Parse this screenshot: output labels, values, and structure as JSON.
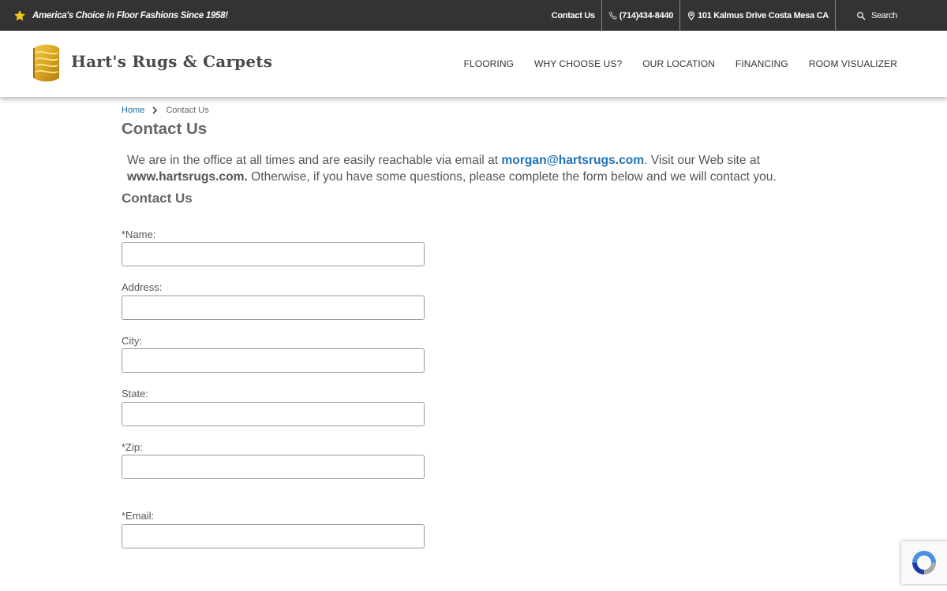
{
  "topbar": {
    "tagline": "America's Choice in Floor Fashions Since 1958!",
    "links": {
      "contact": "Contact Us",
      "phone": "(714)434-8440",
      "address": "101 Kalmus Drive Costa Mesa CA",
      "search": "Search"
    }
  },
  "header": {
    "brand": "Hart's Rugs & Carpets",
    "nav": [
      "FLOORING",
      "WHY CHOOSE US?",
      "OUR LOCATION",
      "FINANCING",
      "ROOM VISUALIZER"
    ]
  },
  "breadcrumb": {
    "home": "Home",
    "current": "Contact Us"
  },
  "page": {
    "title": "Contact Us",
    "intro": {
      "part1": "We are in the office at all times and are easily reachable via email at ",
      "email": "morgan@hartsrugs.com",
      "part2": ". Visit our Web site at ",
      "site": "www.hartsrugs.com.",
      "part3": " Otherwise, if you have some questions, please complete the form below and we will contact you."
    },
    "form_title": "Contact Us"
  },
  "form": {
    "fields": [
      {
        "label": "*Name:",
        "value": ""
      },
      {
        "label": "Address:",
        "value": ""
      },
      {
        "label": "City:",
        "value": ""
      },
      {
        "label": "State:",
        "value": ""
      },
      {
        "label": "*Zip:",
        "value": ""
      },
      {
        "label": "*Email:",
        "value": ""
      }
    ]
  },
  "icons": {
    "star": "star-icon",
    "phone": "phone-icon",
    "pin": "map-pin-icon",
    "search": "search-icon",
    "chevron": "chevron-right-icon",
    "recaptcha": "recaptcha-icon"
  },
  "colors": {
    "topbar_bg": "#333333",
    "star": "#f5c518",
    "link_blue": "#1f73b7",
    "logo_gold": "#d9a520"
  }
}
